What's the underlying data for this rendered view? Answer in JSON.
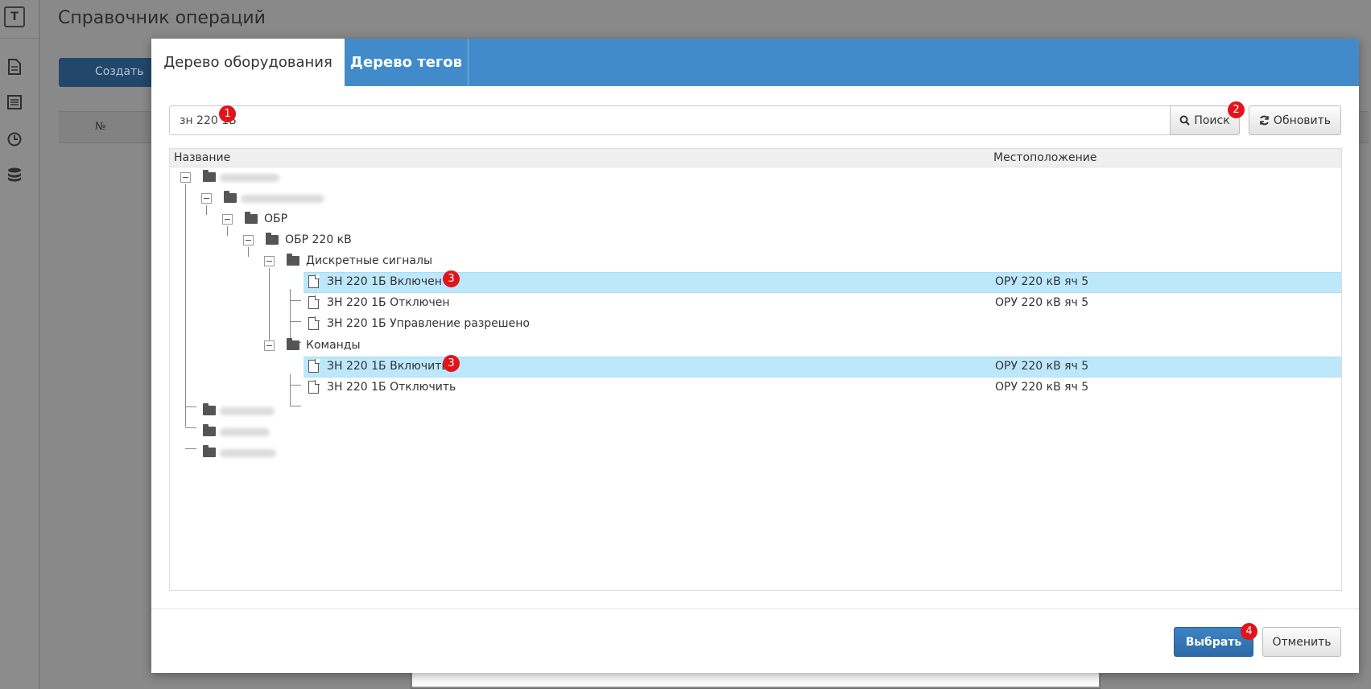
{
  "background": {
    "page_title": "Справочник операций",
    "create_button_label": "Создать",
    "table_col_number": "№"
  },
  "modal": {
    "tabs": [
      {
        "label": "Дерево оборудования",
        "active": true
      },
      {
        "label": "Дерево тегов",
        "active": false
      }
    ],
    "search": {
      "value": "зн 220 1Б",
      "search_button": "Поиск",
      "refresh_button": "Обновить"
    },
    "grid": {
      "columns": [
        "Название",
        "Местоположение"
      ],
      "rows": [
        {
          "label": "",
          "location": ""
        },
        {
          "label": "",
          "location": ""
        },
        {
          "label": "ОБР",
          "location": ""
        },
        {
          "label": "ОБР 220 кВ",
          "location": ""
        },
        {
          "label": "Дискретные сигналы",
          "location": ""
        },
        {
          "label": "ЗН 220 1Б Включен",
          "location": "ОРУ 220 кВ яч 5",
          "selected": true
        },
        {
          "label": "ЗН 220 1Б Отключен",
          "location": "ОРУ 220 кВ яч 5"
        },
        {
          "label": "ЗН 220 1Б Управление разрешено",
          "location": ""
        },
        {
          "label": "Команды",
          "location": ""
        },
        {
          "label": "ЗН 220 1Б Включить",
          "location": "ОРУ 220 кВ яч 5",
          "selected": true
        },
        {
          "label": "ЗН 220 1Б Отключить",
          "location": "ОРУ 220 кВ яч 5"
        },
        {
          "label": "",
          "location": ""
        },
        {
          "label": "",
          "location": ""
        },
        {
          "label": "",
          "location": ""
        }
      ]
    },
    "footer": {
      "select_button": "Выбрать",
      "cancel_button": "Отменить"
    }
  },
  "annotations": {
    "badge_1": "1",
    "badge_2": "2",
    "badge_3a": "3",
    "badge_3b": "3",
    "badge_4": "4"
  },
  "colors": {
    "tab_bar": "#428bca",
    "selected_row": "#bde8fc",
    "primary_button": "#3071a9",
    "badge": "#e2141b"
  }
}
